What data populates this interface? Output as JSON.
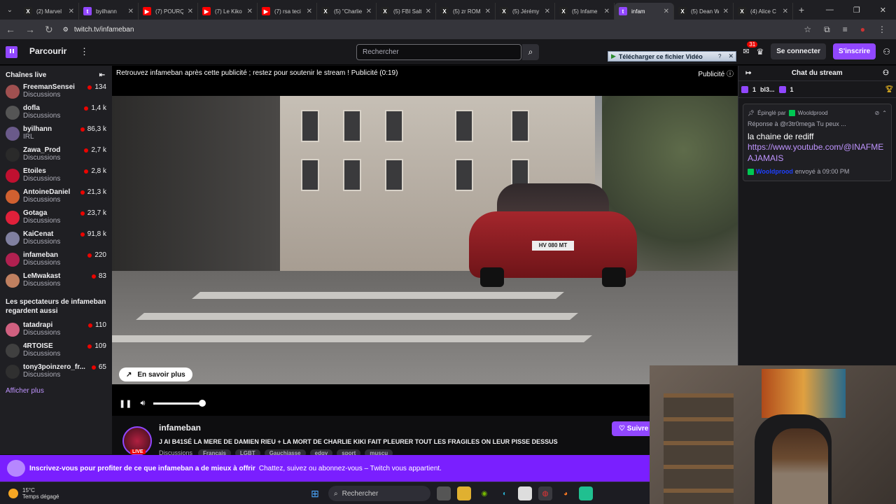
{
  "browser": {
    "tabs": [
      {
        "fav": "X",
        "title": "(2) Marvel",
        "color": "#222222"
      },
      {
        "fav": "t",
        "title": "byilhann",
        "color": "#9147ff"
      },
      {
        "fav": "▶",
        "title": "(7) POURQ",
        "color": "#ff0000"
      },
      {
        "fav": "▶",
        "title": "(7) Le Kiko",
        "color": "#ff0000"
      },
      {
        "fav": "▶",
        "title": "(7) rsa teci",
        "color": "#ff0000"
      },
      {
        "fav": "X",
        "title": "(5) \"Charlie",
        "color": "#222222"
      },
      {
        "fav": "X",
        "title": "(5) FBI Salt",
        "color": "#222222"
      },
      {
        "fav": "X",
        "title": "(5) zr ROM",
        "color": "#222222"
      },
      {
        "fav": "X",
        "title": "(5) Jérémy",
        "color": "#222222"
      },
      {
        "fav": "X",
        "title": "(5) Infame",
        "color": "#222222"
      },
      {
        "fav": "t",
        "title": "infam",
        "color": "#9147ff",
        "active": true
      },
      {
        "fav": "X",
        "title": "(5) Dean W",
        "color": "#222222"
      },
      {
        "fav": "X",
        "title": "(4) Alice C",
        "color": "#222222"
      }
    ],
    "url": "twitch.tv/infameban"
  },
  "topnav": {
    "browse": "Parcourir",
    "search_placeholder": "Rechercher",
    "idm_label": "Télécharger ce fichier Vidéo",
    "idm_badge": "?",
    "notif_count": "31",
    "login": "Se connecter",
    "signup": "S'inscrire"
  },
  "sidebar": {
    "title": "Chaînes live",
    "channels": [
      {
        "name": "FreemanSensei",
        "category": "Discussions",
        "viewers": "134",
        "color": "#a05050"
      },
      {
        "name": "dofla",
        "category": "Discussions",
        "viewers": "1,4 k",
        "color": "#555555"
      },
      {
        "name": "byilhann",
        "category": "IRL",
        "viewers": "86,3 k",
        "color": "#6a5a8a"
      },
      {
        "name": "Zawa_Prod",
        "category": "Discussions",
        "viewers": "2,7 k",
        "color": "#2a2a2a"
      },
      {
        "name": "Etoiles",
        "category": "Discussions",
        "viewers": "2,8 k",
        "color": "#c01030"
      },
      {
        "name": "AntoineDaniel",
        "category": "Discussions",
        "viewers": "21,3 k",
        "color": "#d06030"
      },
      {
        "name": "Gotaga",
        "category": "Discussions",
        "viewers": "23,7 k",
        "color": "#e0203a"
      },
      {
        "name": "KaiCenat",
        "category": "Discussions",
        "viewers": "91,8 k",
        "color": "#8080a0"
      },
      {
        "name": "infameban",
        "category": "Discussions",
        "viewers": "220",
        "color": "#b02050"
      },
      {
        "name": "LeMwakast",
        "category": "Discussions",
        "viewers": "83",
        "color": "#c08060"
      }
    ],
    "viewers_title": "Les spectateurs de infameban regardent aussi",
    "also": [
      {
        "name": "tatadrapi",
        "category": "Discussions",
        "viewers": "110",
        "color": "#d06080"
      },
      {
        "name": "4RTOISE",
        "category": "Discussions",
        "viewers": "109",
        "color": "#404040"
      },
      {
        "name": "tony3poinzero_fr...",
        "category": "Discussions",
        "viewers": "65",
        "color": "#303030"
      }
    ],
    "show_more": "Afficher plus"
  },
  "player": {
    "ad_text": "Retrouvez infameban après cette publicité ; restez pour soutenir le stream ! Publicité (0:19)",
    "ad_label": "Publicité",
    "plate": "HV 080 MT",
    "learn_more": "En savoir plus",
    "volume_level": 1.0
  },
  "stream_info": {
    "name": "infameban",
    "live": "LIVE",
    "title": "J AI B41SÉ LA MERE DE DAMIEN RIEU + LA MORT DE CHARLIE KIKI FAIT PLEURER TOUT LES FRAGILES ON LEUR PISSE DESSUS",
    "category": "Discussions",
    "tags": [
      "Français",
      "LGBT",
      "Gauchiasse",
      "edgy",
      "sport",
      "muscu"
    ],
    "follow": "Suivre"
  },
  "chat": {
    "title": "Chat du stream",
    "gift_count_1": "1",
    "gift_user": "bl3...",
    "gift_count_2": "1",
    "pinned_by": "Épinglé par",
    "pinned_user": "Wooldprood",
    "reply": "Réponse à @r3tr0mega Tu peux ...",
    "message": "la chaine de rediff",
    "link": "https://www.youtube.com/@INAFMEAJAMAIS",
    "sent_user": "Wooldprood",
    "sent": "envoyé à 09:00 PM"
  },
  "promo": {
    "bold": "Inscrivez-vous pour profiter de ce que infameban a de mieux à offrir",
    "text": "Chattez, suivez ou abonnez-vous – Twitch vous appartient."
  },
  "taskbar": {
    "temp": "15°C",
    "weather": "Temps dégagé",
    "search": "Rechercher"
  }
}
